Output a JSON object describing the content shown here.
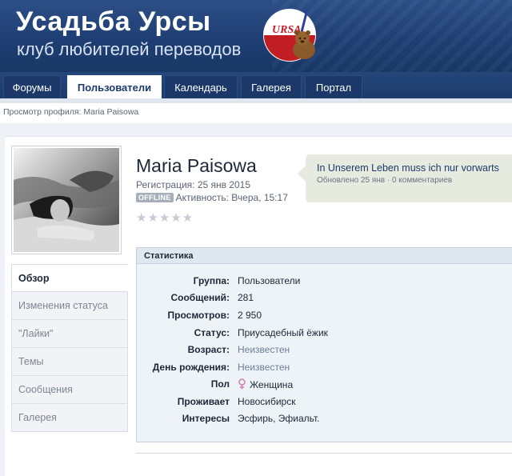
{
  "header": {
    "title": "Усадьба Урсы",
    "subtitle": "клуб любителей переводов",
    "logo_text": "URSA",
    "colors": {
      "background": "#1f3f74",
      "logo_red": "#c21c24"
    }
  },
  "nav": {
    "tabs": [
      {
        "label": "Форумы",
        "active": false
      },
      {
        "label": "Пользователи",
        "active": true
      },
      {
        "label": "Календарь",
        "active": false
      },
      {
        "label": "Галерея",
        "active": false
      },
      {
        "label": "Портал",
        "active": false
      }
    ]
  },
  "breadcrumb": "Просмотр профиля: Maria Paisowa",
  "profile": {
    "name": "Maria Paisowa",
    "registration": "Регистрация: 25 янв 2015",
    "offline_badge": "OFFLINE",
    "activity": "Активность: Вчера, 15:17",
    "rating_stars": "★★★★★",
    "rating_value": 0
  },
  "status_update": {
    "text": "In Unserem Leben muss ich nur vorwarts",
    "meta": "Обновлено 25 янв · 0 комментариев"
  },
  "side_menu": [
    {
      "label": "Обзор",
      "active": true
    },
    {
      "label": "Изменения статуса",
      "active": false
    },
    {
      "label": "\"Лайки\"",
      "active": false
    },
    {
      "label": "Темы",
      "active": false
    },
    {
      "label": "Сообщения",
      "active": false
    },
    {
      "label": "Галерея",
      "active": false
    }
  ],
  "stats": {
    "title": "Статистика",
    "rows": [
      {
        "label": "Группа:",
        "value": "Пользователи"
      },
      {
        "label": "Сообщений:",
        "value": "281"
      },
      {
        "label": "Просмотров:",
        "value": "2 950"
      },
      {
        "label": "Статус:",
        "value": "Приусадебный ёжик"
      },
      {
        "label": "Возраст:",
        "value": "Неизвестен"
      },
      {
        "label": "День рождения:",
        "value": "Неизвестен"
      },
      {
        "label": "Пол",
        "value": "Женщина",
        "icon": "female-symbol-icon"
      },
      {
        "label": "Проживает",
        "value": "Новосибирск"
      },
      {
        "label": "Интересы",
        "value": "Эсфирь, Эфиальт."
      }
    ]
  }
}
